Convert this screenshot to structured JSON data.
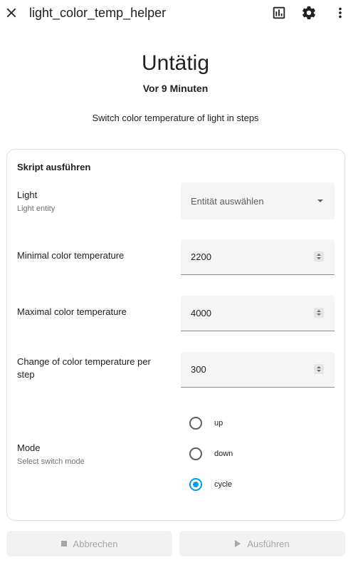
{
  "header": {
    "title": "light_color_temp_helper",
    "close_icon": "close-icon",
    "history_icon": "chart-icon",
    "settings_icon": "gear-icon",
    "more_icon": "more-vertical-icon"
  },
  "status": {
    "state": "Untätig",
    "since": "Vor 9 Minuten",
    "description": "Switch color temperature of light in steps"
  },
  "form": {
    "title": "Skript ausführen",
    "light": {
      "label": "Light",
      "sublabel": "Light entity",
      "placeholder": "Entität auswählen"
    },
    "min_temp": {
      "label": "Minimal color temperature",
      "value": "2200"
    },
    "max_temp": {
      "label": "Maximal color temperature",
      "value": "4000"
    },
    "step": {
      "label": "Change of color temperature per step",
      "value": "300"
    },
    "mode": {
      "label": "Mode",
      "sublabel": "Select switch mode",
      "options": [
        {
          "label": "up",
          "checked": false
        },
        {
          "label": "down",
          "checked": false
        },
        {
          "label": "cycle",
          "checked": true
        }
      ]
    }
  },
  "actions": {
    "cancel_label": "Abbrechen",
    "run_label": "Ausführen"
  },
  "colors": {
    "accent": "#039be5",
    "disabled_text": "#a6a6a6"
  }
}
